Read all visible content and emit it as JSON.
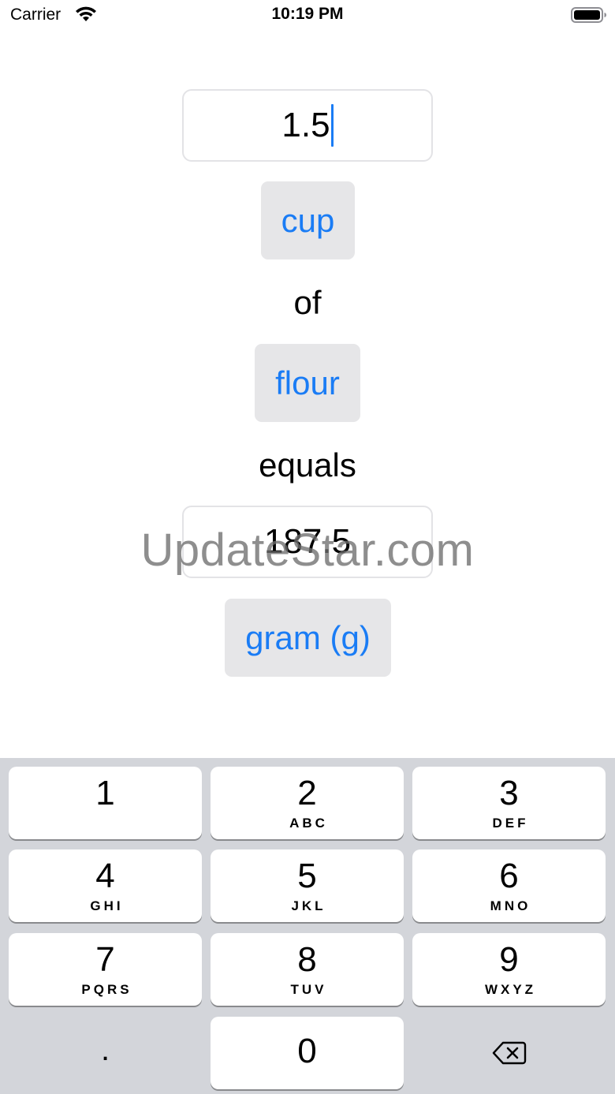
{
  "status_bar": {
    "carrier": "Carrier",
    "time": "10:19 PM",
    "icons": [
      "wifi-icon",
      "battery-icon"
    ]
  },
  "converter": {
    "amount_value": "1.5",
    "from_unit": "cup",
    "of_text": "of",
    "ingredient": "flour",
    "equals_text": "equals",
    "result_value": "187.5",
    "to_unit": "gram (g)",
    "accent_color": "#1a7cf5"
  },
  "watermark": "UpdateStar.com",
  "keypad": {
    "keys": [
      {
        "num": "1",
        "letters": ""
      },
      {
        "num": "2",
        "letters": "ABC"
      },
      {
        "num": "3",
        "letters": "DEF"
      },
      {
        "num": "4",
        "letters": "GHI"
      },
      {
        "num": "5",
        "letters": "JKL"
      },
      {
        "num": "6",
        "letters": "MNO"
      },
      {
        "num": "7",
        "letters": "PQRS"
      },
      {
        "num": "8",
        "letters": "TUV"
      },
      {
        "num": "9",
        "letters": "WXYZ"
      },
      {
        "num": "0",
        "letters": ""
      }
    ],
    "decimal": ".",
    "delete_icon": "backspace-icon"
  }
}
